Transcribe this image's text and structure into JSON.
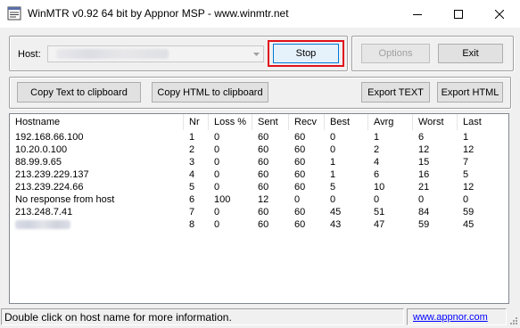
{
  "window": {
    "title": "WinMTR v0.92 64 bit by Appnor MSP - www.winmtr.net",
    "controls": [
      "minimize-icon",
      "maximize-icon",
      "close-icon"
    ]
  },
  "host_group": {
    "label": "Host:",
    "value_redacted": true,
    "stop_label": "Stop",
    "highlight_color": "#e0101a"
  },
  "options_group": {
    "options_label": "Options",
    "exit_label": "Exit"
  },
  "export_group": {
    "copy_text_label": "Copy Text to clipboard",
    "copy_html_label": "Copy HTML to clipboard",
    "export_text_label": "Export TEXT",
    "export_html_label": "Export HTML"
  },
  "table": {
    "columns": [
      "Hostname",
      "Nr",
      "Loss %",
      "Sent",
      "Recv",
      "Best",
      "Avrg",
      "Worst",
      "Last"
    ],
    "rows": [
      [
        "192.168.66.100",
        "1",
        "0",
        "60",
        "60",
        "0",
        "1",
        "6",
        "1"
      ],
      [
        "10.20.0.100",
        "2",
        "0",
        "60",
        "60",
        "0",
        "2",
        "12",
        "12"
      ],
      [
        "88.99.9.65",
        "3",
        "0",
        "60",
        "60",
        "1",
        "4",
        "15",
        "7"
      ],
      [
        "213.239.229.137",
        "4",
        "0",
        "60",
        "60",
        "1",
        "6",
        "16",
        "5"
      ],
      [
        "213.239.224.66",
        "5",
        "0",
        "60",
        "60",
        "5",
        "10",
        "21",
        "12"
      ],
      [
        "No response from host",
        "6",
        "100",
        "12",
        "0",
        "0",
        "0",
        "0",
        "0"
      ],
      [
        "213.248.7.41",
        "7",
        "0",
        "60",
        "60",
        "45",
        "51",
        "84",
        "59"
      ],
      [
        "",
        "8",
        "0",
        "60",
        "60",
        "43",
        "47",
        "59",
        "45"
      ]
    ],
    "redacted_rows": [
      7
    ]
  },
  "statusbar": {
    "message": "Double click on host name for more information.",
    "link": "www.appnor.com"
  },
  "colors": {
    "window_bg": "#f0f0f0",
    "link": "#0000ff",
    "stop_highlight": "#e0101a"
  }
}
